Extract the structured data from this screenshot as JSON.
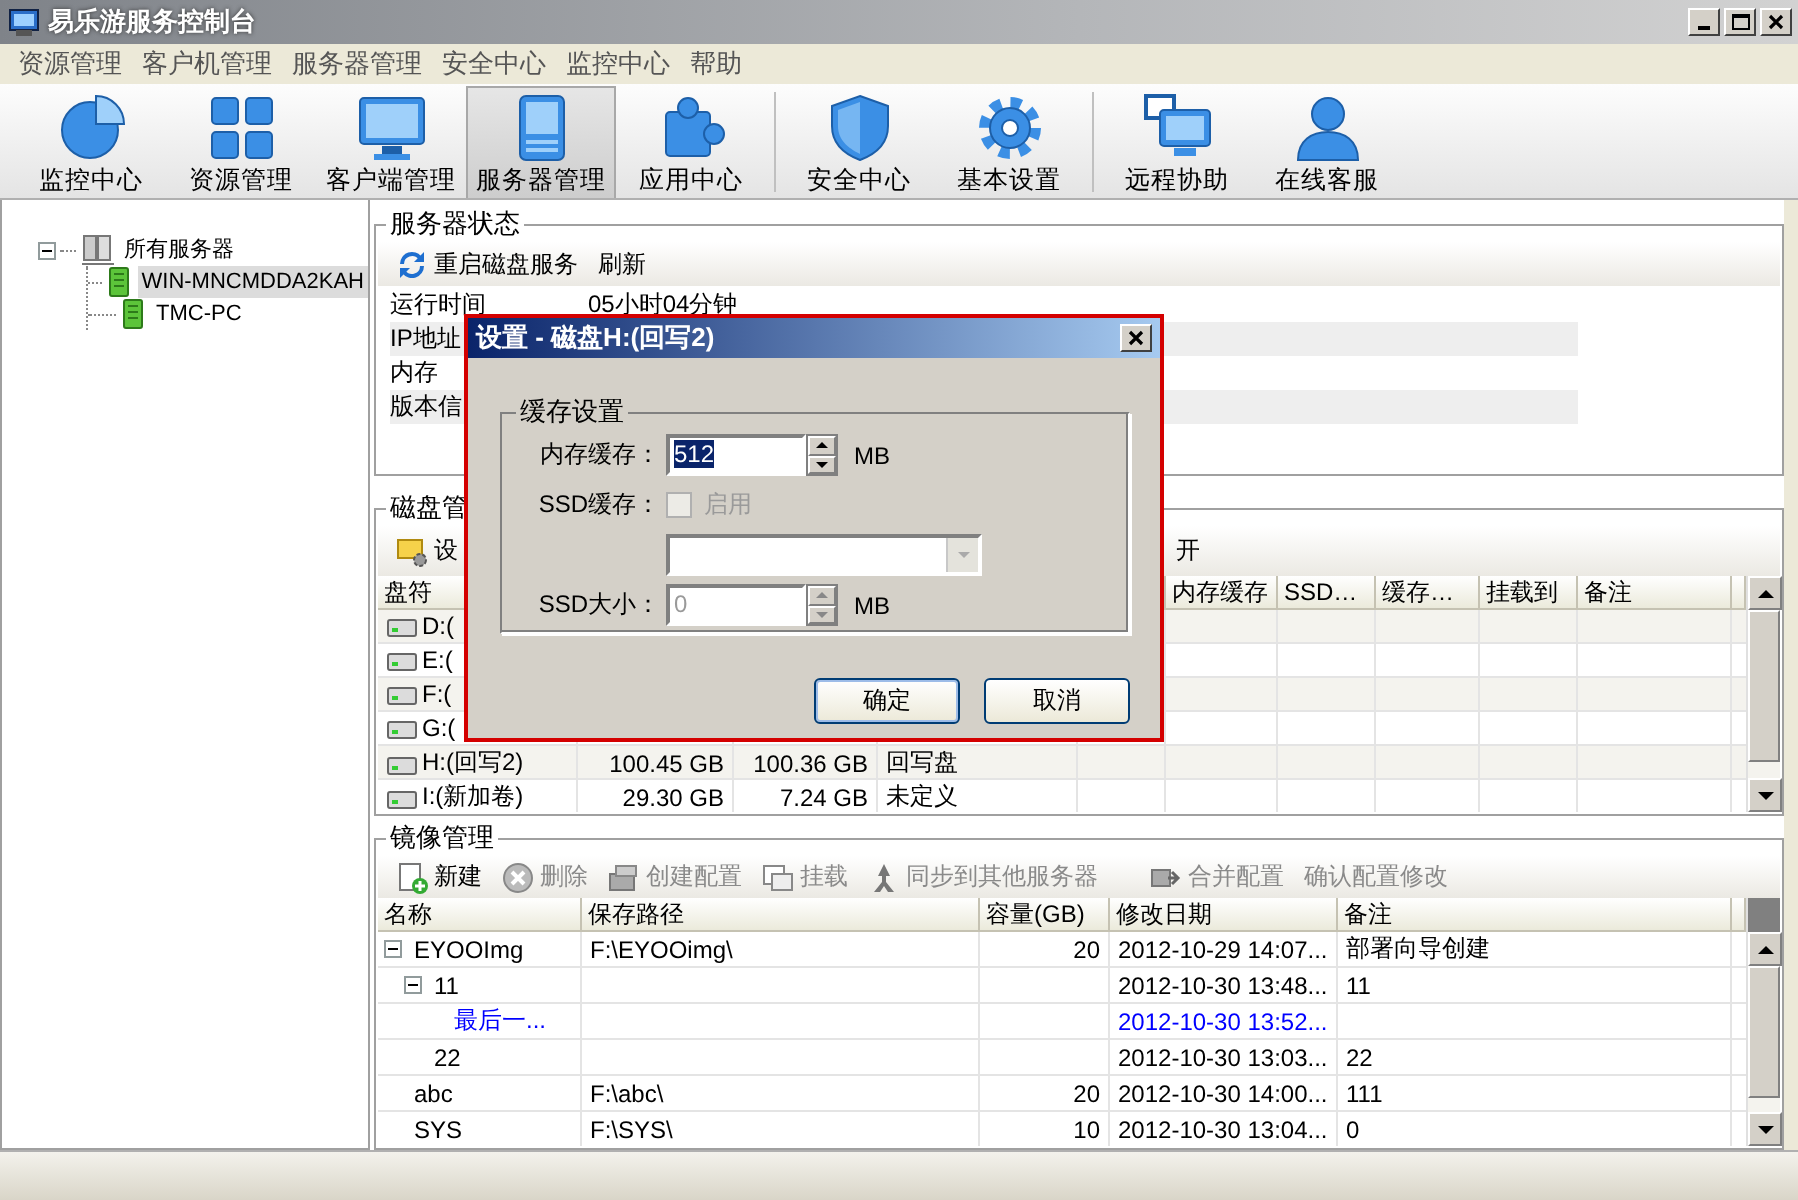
{
  "window": {
    "title": "易乐游服务控制台"
  },
  "menu": [
    "资源管理",
    "客户机管理",
    "服务器管理",
    "安全中心",
    "监控中心",
    "帮助"
  ],
  "toolbar": [
    [
      {
        "label": "监控中心",
        "selected": false
      },
      {
        "label": "资源管理",
        "selected": false
      },
      {
        "label": "客户端管理",
        "selected": false
      },
      {
        "label": "服务器管理",
        "selected": true
      },
      {
        "label": "应用中心",
        "selected": false
      }
    ],
    [
      {
        "label": "安全中心",
        "selected": false
      },
      {
        "label": "基本设置",
        "selected": false
      }
    ],
    [
      {
        "label": "远程协助",
        "selected": false
      },
      {
        "label": "在线客服",
        "selected": false
      }
    ]
  ],
  "server_tree": {
    "label": "所有服务器",
    "expanded": true,
    "children": [
      {
        "label": "WIN-MNCMDDA2KAH",
        "selected": true
      },
      {
        "label": "TMC-PC",
        "selected": false
      }
    ]
  },
  "server_status": {
    "title": "服务器状态",
    "actions": [
      {
        "label": "重启磁盘服务"
      },
      {
        "label": "刷新"
      }
    ],
    "rows": [
      {
        "label": "运行时间",
        "value": "05小时04分钟"
      },
      {
        "label": "IP地址"
      },
      {
        "label": "内存"
      },
      {
        "label": "版本信"
      }
    ]
  },
  "disk_management": {
    "title": "磁盘管",
    "actions": [
      {
        "label": "设"
      },
      {
        "label": "开"
      }
    ],
    "columns": [
      "盘符",
      "内存缓存",
      "SSD…",
      "缓存…",
      "挂载到",
      "备注"
    ],
    "rows": [
      {
        "drive": "D:("
      },
      {
        "drive": "E:("
      },
      {
        "drive": "F:("
      },
      {
        "drive": "G:("
      },
      {
        "drive": "H:(回写2)",
        "column_2": "100.45 GB",
        "column_3": "100.36 GB",
        "column_4": "回写盘"
      },
      {
        "drive": "I:(新加卷)",
        "column_2": "29.30 GB",
        "column_3": "7.24 GB",
        "column_4": "未定义"
      }
    ]
  },
  "mirror_management": {
    "title": "镜像管理",
    "actions": [
      [
        {
          "label": "新建",
          "disabled": false
        },
        {
          "label": "删除",
          "disabled": true
        },
        {
          "label": "创建配置",
          "disabled": true
        },
        {
          "label": "挂载",
          "disabled": true
        },
        {
          "label": "同步到其他服务器",
          "disabled": true
        }
      ],
      [
        {
          "label": "合并配置",
          "disabled": true
        },
        {
          "label": "确认配置修改",
          "disabled": true
        }
      ]
    ],
    "columns": [
      "名称",
      "保存路径",
      "容量(GB)",
      "修改日期",
      "备注"
    ],
    "rows": [
      {
        "name": "EYOOImg",
        "path": "F:\\EYOOimg\\",
        "size": "20",
        "modified": "2012-10-29 14:07...",
        "note": "部署向导创建",
        "expanded": true,
        "children": [
          {
            "name": "11",
            "modified": "2012-10-30 13:48...",
            "note": "11",
            "expanded": true,
            "children": [
              {
                "name": "最后一...",
                "modified": "2012-10-30 13:52...",
                "current": true
              }
            ]
          },
          {
            "name": "22",
            "modified": "2012-10-30 13:03...",
            "note": "22",
            "current": false
          }
        ]
      },
      {
        "name": "abc",
        "path": "F:\\abc\\",
        "size": "20",
        "modified": "2012-10-30 14:00...",
        "note": "111",
        "current": false
      },
      {
        "name": "SYS",
        "path": "F:\\SYS\\",
        "size": "10",
        "modified": "2012-10-30 13:04...",
        "note": "0",
        "current": false
      }
    ]
  },
  "dialog": {
    "title": "设置 - 磁盘H:(回写2)",
    "group": "缓存设置",
    "memory_cache": {
      "label": "内存缓存：",
      "value": "512",
      "value_selected": true,
      "unit": "MB"
    },
    "ssd_cache": {
      "label": "SSD缓存：",
      "checkbox": "启用",
      "checked": false,
      "disabled": true
    },
    "ssd_device": {
      "disabled": true
    },
    "ssd_size": {
      "label": "SSD大小：",
      "value": "0",
      "unit": "MB",
      "disabled": true
    },
    "buttons": [
      {
        "label": "确定",
        "default": true
      },
      {
        "label": "取消",
        "default": false
      }
    ]
  }
}
